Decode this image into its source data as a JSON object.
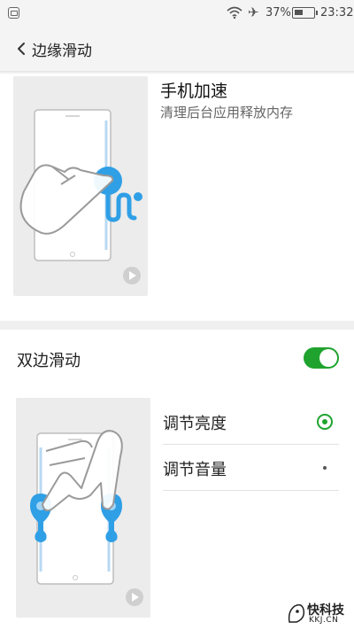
{
  "status_bar": {
    "battery_percent": "37%",
    "time": "23:32",
    "icons": [
      "notification-icon",
      "wifi-icon",
      "airplane-icon",
      "battery-icon"
    ]
  },
  "header": {
    "title": "边缘滑动",
    "back_icon": "back-chevron-icon"
  },
  "speed_up": {
    "title": "手机加速",
    "subtitle": "清理后台应用释放内存",
    "illustration": "single-edge-swipe-gesture",
    "play_icon": "play-icon"
  },
  "double_swipe": {
    "label": "双边滑动",
    "enabled": true,
    "illustration": "double-edge-swipe-gesture",
    "play_icon": "play-icon",
    "options": [
      {
        "label": "调节亮度",
        "selected": true
      },
      {
        "label": "调节音量",
        "selected": false
      }
    ]
  },
  "watermark": {
    "main": "快科技",
    "sub": "KKJ.CN"
  },
  "colors": {
    "accent_green": "#1fa32e",
    "gesture_blue": "#2f9fe6",
    "panel_gray": "#ececec"
  }
}
